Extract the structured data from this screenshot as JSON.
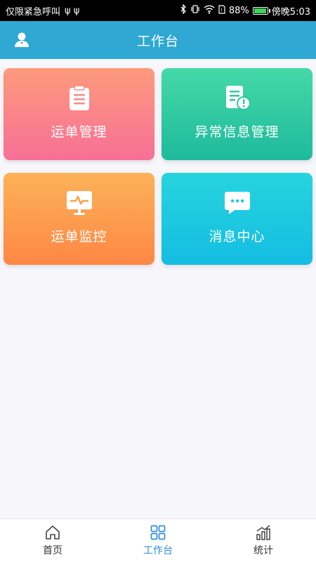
{
  "status_bar": {
    "left_text": "仅限紧急呼叫",
    "usb_icons": "ψ ψ",
    "battery_percent": "88%",
    "time": "傍晚5:03"
  },
  "header": {
    "title": "工作台",
    "user_icon": "user-icon"
  },
  "tiles": [
    {
      "label": "运单管理",
      "icon": "clipboard-icon"
    },
    {
      "label": "异常信息管理",
      "icon": "document-alert-icon"
    },
    {
      "label": "运单监控",
      "icon": "monitor-pulse-icon"
    },
    {
      "label": "消息中心",
      "icon": "chat-bubble-icon"
    }
  ],
  "bottom_nav": {
    "items": [
      {
        "label": "首页",
        "icon": "home-icon",
        "active": false
      },
      {
        "label": "工作台",
        "icon": "grid-icon",
        "active": true
      },
      {
        "label": "统计",
        "icon": "bar-chart-icon",
        "active": false
      }
    ],
    "active_color": "#2b8fd6"
  },
  "colors": {
    "header": "#2fa8d3",
    "tile_waybill": "#f77096",
    "tile_exception": "#1fba9e",
    "tile_monitor": "#ff8744",
    "tile_message": "#14bde2"
  }
}
